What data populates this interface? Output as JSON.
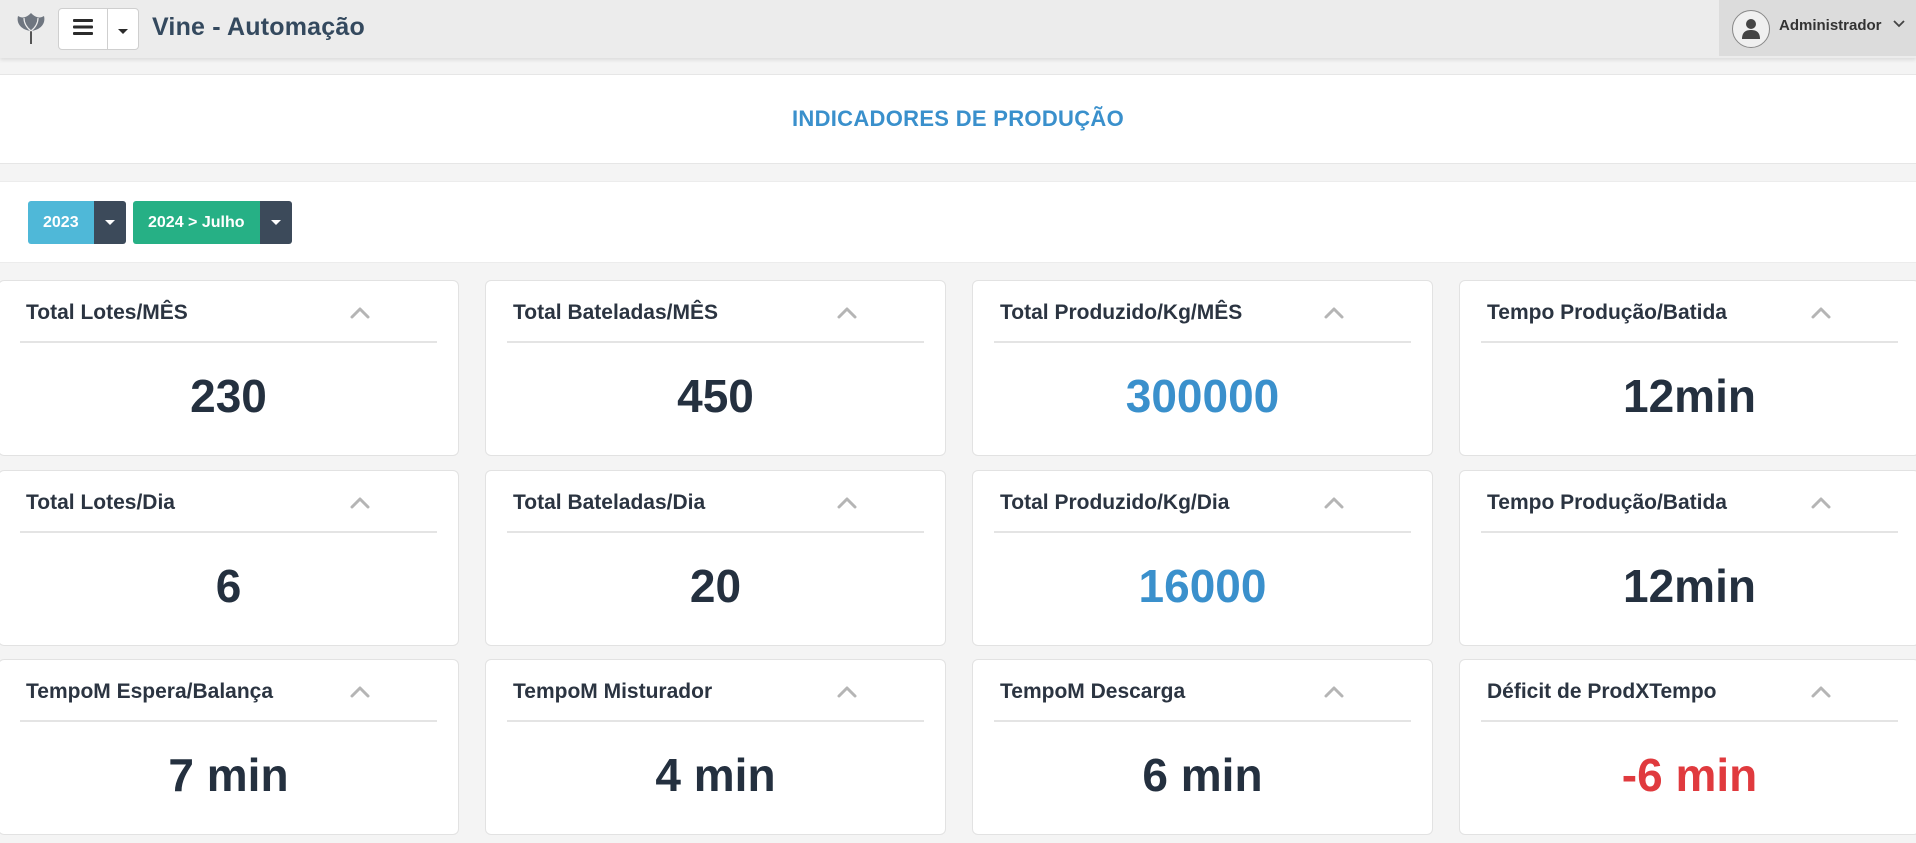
{
  "header": {
    "app_title": "Vine - Automação",
    "user_name": "Administrador"
  },
  "page": {
    "title": "INDICADORES DE PRODUÇÃO"
  },
  "filters": [
    {
      "label": "2023",
      "color": "#4fb8d8"
    },
    {
      "label": "2024 > Julho",
      "color": "#26b085"
    }
  ],
  "colors": {
    "value_default": "#24303f",
    "value_highlight": "#3a90cc",
    "value_negative": "#e03a3e"
  },
  "cards": [
    {
      "title": "Total Lotes/MÊS",
      "value": "230",
      "tone": "default"
    },
    {
      "title": "Total Bateladas/MÊS",
      "value": "450",
      "tone": "default"
    },
    {
      "title": "Total Produzido/Kg/MÊS",
      "value": "300000",
      "tone": "highlight"
    },
    {
      "title": "Tempo Produção/Batida",
      "value": "12min",
      "tone": "default"
    },
    {
      "title": "Total Lotes/Dia",
      "value": "6",
      "tone": "default"
    },
    {
      "title": "Total Bateladas/Dia",
      "value": "20",
      "tone": "default"
    },
    {
      "title": "Total Produzido/Kg/Dia",
      "value": "16000",
      "tone": "highlight"
    },
    {
      "title": "Tempo Produção/Batida",
      "value": "12min",
      "tone": "default"
    },
    {
      "title": "TempoM Espera/Balança",
      "value": "7 min",
      "tone": "default"
    },
    {
      "title": "TempoM Misturador",
      "value": "4 min",
      "tone": "default"
    },
    {
      "title": "TempoM Descarga",
      "value": "6 min",
      "tone": "default"
    },
    {
      "title": "Déficit de ProdXTempo",
      "value": "-6 min",
      "tone": "negative"
    }
  ]
}
